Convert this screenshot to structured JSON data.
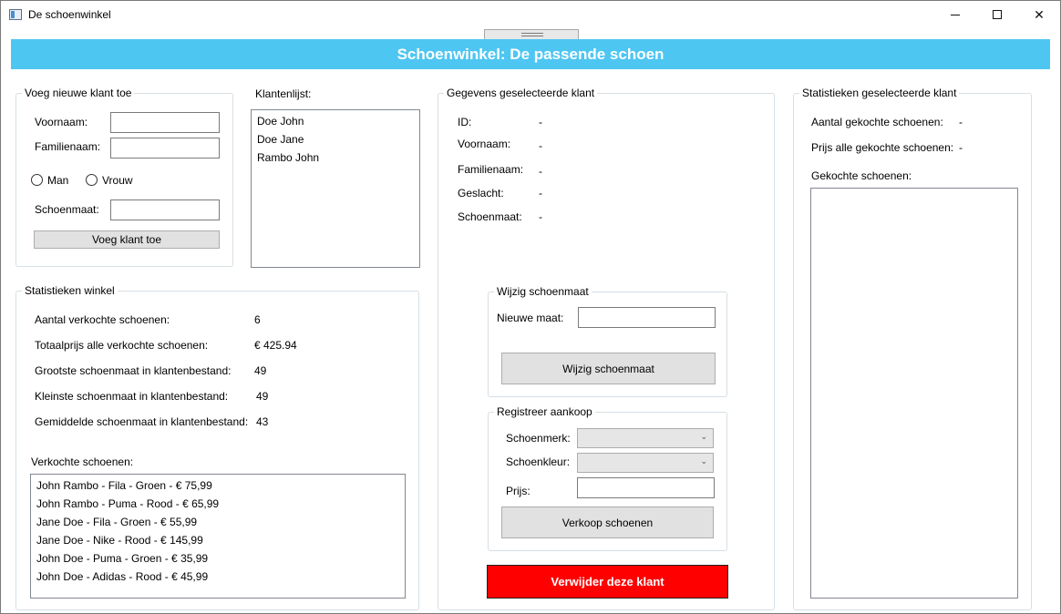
{
  "window": {
    "title": "De schoenwinkel"
  },
  "header": {
    "title": "Schoenwinkel: De passende schoen"
  },
  "new_customer": {
    "group_title": "Voeg nieuwe klant toe",
    "first_name_label": "Voornaam:",
    "first_name_value": "",
    "last_name_label": "Familienaam:",
    "last_name_value": "",
    "gender_male_label": "Man",
    "gender_female_label": "Vrouw",
    "shoe_size_label": "Schoenmaat:",
    "shoe_size_value": "",
    "add_button_label": "Voeg klant toe"
  },
  "customer_list": {
    "label": "Klantenlijst:",
    "items": [
      "Doe John",
      "Doe Jane",
      "Rambo John"
    ]
  },
  "selected_customer": {
    "group_title": "Gegevens geselecteerde klant",
    "fields": [
      {
        "label": "ID:",
        "value": "-"
      },
      {
        "label": "Voornaam:",
        "value": "-"
      },
      {
        "label": "Familienaam:",
        "value": "-"
      },
      {
        "label": "Geslacht:",
        "value": "-"
      },
      {
        "label": "Schoenmaat:",
        "value": "-"
      }
    ]
  },
  "change_size": {
    "group_title": "Wijzig schoenmaat",
    "new_size_label": "Nieuwe maat:",
    "new_size_value": "",
    "button_label": "Wijzig schoenmaat"
  },
  "purchase": {
    "group_title": "Registreer aankoop",
    "brand_label": "Schoenmerk:",
    "brand_value": "",
    "color_label": "Schoenkleur:",
    "color_value": "",
    "price_label": "Prijs:",
    "price_value": "",
    "button_label": "Verkoop schoenen"
  },
  "delete_button_label": "Verwijder deze klant",
  "store_stats": {
    "group_title": "Statistieken winkel",
    "rows": [
      {
        "label": "Aantal verkochte schoenen:",
        "value": "6"
      },
      {
        "label": "Totaalprijs alle verkochte schoenen:",
        "value": "€ 425.94"
      },
      {
        "label": "Grootste schoenmaat in klantenbestand:",
        "value": "49"
      },
      {
        "label": "Kleinste schoenmaat in klantenbestand:",
        "value": "49"
      },
      {
        "label": "Gemiddelde schoenmaat in klantenbestand:",
        "value": "43"
      }
    ],
    "sold_label": "Verkochte schoenen:",
    "sold_items": [
      "John Rambo - Fila - Groen - € 75,99",
      "John Rambo - Puma - Rood - € 65,99",
      "Jane Doe - Fila - Groen - € 55,99",
      "Jane Doe - Nike - Rood - € 145,99",
      "John Doe - Puma - Groen - € 35,99",
      "John Doe - Adidas - Rood - € 45,99"
    ]
  },
  "customer_stats": {
    "group_title": "Statistieken geselecteerde klant",
    "count_label": "Aantal gekochte schoenen:",
    "count_value": "-",
    "price_label": "Prijs alle gekochte schoenen:",
    "price_value": "-",
    "bought_label": "Gekochte schoenen:",
    "bought_items": []
  }
}
